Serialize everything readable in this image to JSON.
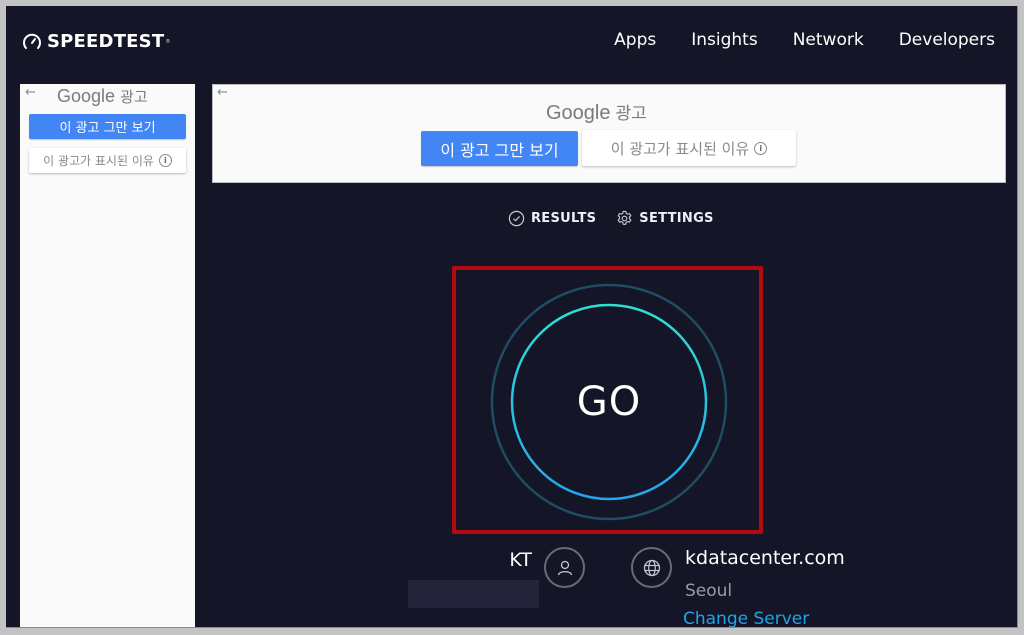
{
  "header": {
    "brand": "SPEEDTEST",
    "brand_mark": "®",
    "logo_icon": "speedometer-icon",
    "nav": [
      {
        "label": "Apps"
      },
      {
        "label": "Insights"
      },
      {
        "label": "Network"
      },
      {
        "label": "Developers"
      }
    ]
  },
  "ads": {
    "left": {
      "back_icon": "arrow-left-icon",
      "title_brand": "Google",
      "title_suffix": "광고",
      "stop_button": "이 광고 그만 보기",
      "why_button": "이 광고가 표시된 이유",
      "info_icon": "info-icon"
    },
    "top": {
      "back_icon": "arrow-left-icon",
      "title_brand": "Google",
      "title_suffix": "광고",
      "stop_button": "이 광고 그만 보기",
      "why_button": "이 광고가 표시된 이유",
      "info_icon": "info-icon"
    }
  },
  "tabs": [
    {
      "label": "RESULTS",
      "icon": "check-circle-icon"
    },
    {
      "label": "SETTINGS",
      "icon": "gear-icon"
    }
  ],
  "go_button": {
    "label": "GO"
  },
  "provider": {
    "name": "KT",
    "icon": "user-icon"
  },
  "server": {
    "icon": "globe-icon",
    "name": "kdatacenter.com",
    "city": "Seoul",
    "change_label": "Change Server"
  },
  "colors": {
    "background": "#141526",
    "highlight_border": "#b30b0f",
    "accent_blue": "#1ea5e9",
    "ring_teal": "#2fd3d0",
    "ad_button_blue": "#4285f4"
  }
}
